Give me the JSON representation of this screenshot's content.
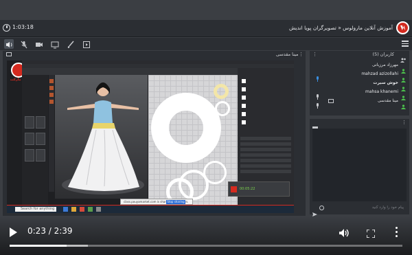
{
  "topbar": {
    "elapsed": "1:03:18",
    "course_title": "آموزش آنلاین مارولوس « تصویرگران پویا اندیش"
  },
  "presenter": {
    "name": "مینا مقدسی"
  },
  "shared_screen": {
    "watermark_label": "پویا مارکت",
    "taskbar_search": "Search for anything",
    "popup_text": "class.pouyamarket.com is sharing your screen.",
    "popup_button": "Stop sharing",
    "recorder_time": "00:05:22"
  },
  "users": {
    "header": "کاربران (5)",
    "list": [
      {
        "name": "مهرزاد مرزبانی",
        "bold": false,
        "mic": false,
        "desktop": false
      },
      {
        "name": "mahzad azizollahi",
        "bold": false,
        "mic": true,
        "desktop": false
      },
      {
        "name": "خوش سیرت",
        "bold": true,
        "mic": false,
        "desktop": false
      },
      {
        "name": "mahsa khanemi",
        "bold": false,
        "mic": true,
        "desktop": false
      },
      {
        "name": "مینا مقدسی",
        "bold": false,
        "mic": true,
        "desktop": true
      }
    ]
  },
  "chat": {
    "placeholder": "پیام خود را وارد کنید"
  },
  "video": {
    "time_display": "0:23 / 2:39",
    "progress_fraction": 0.145,
    "buffered_fraction": 0.2
  },
  "colors": {
    "accent": "#d42a1f",
    "panel": "#2b2e33",
    "online": "#4cc24c",
    "mic": "#3a8fe0"
  }
}
